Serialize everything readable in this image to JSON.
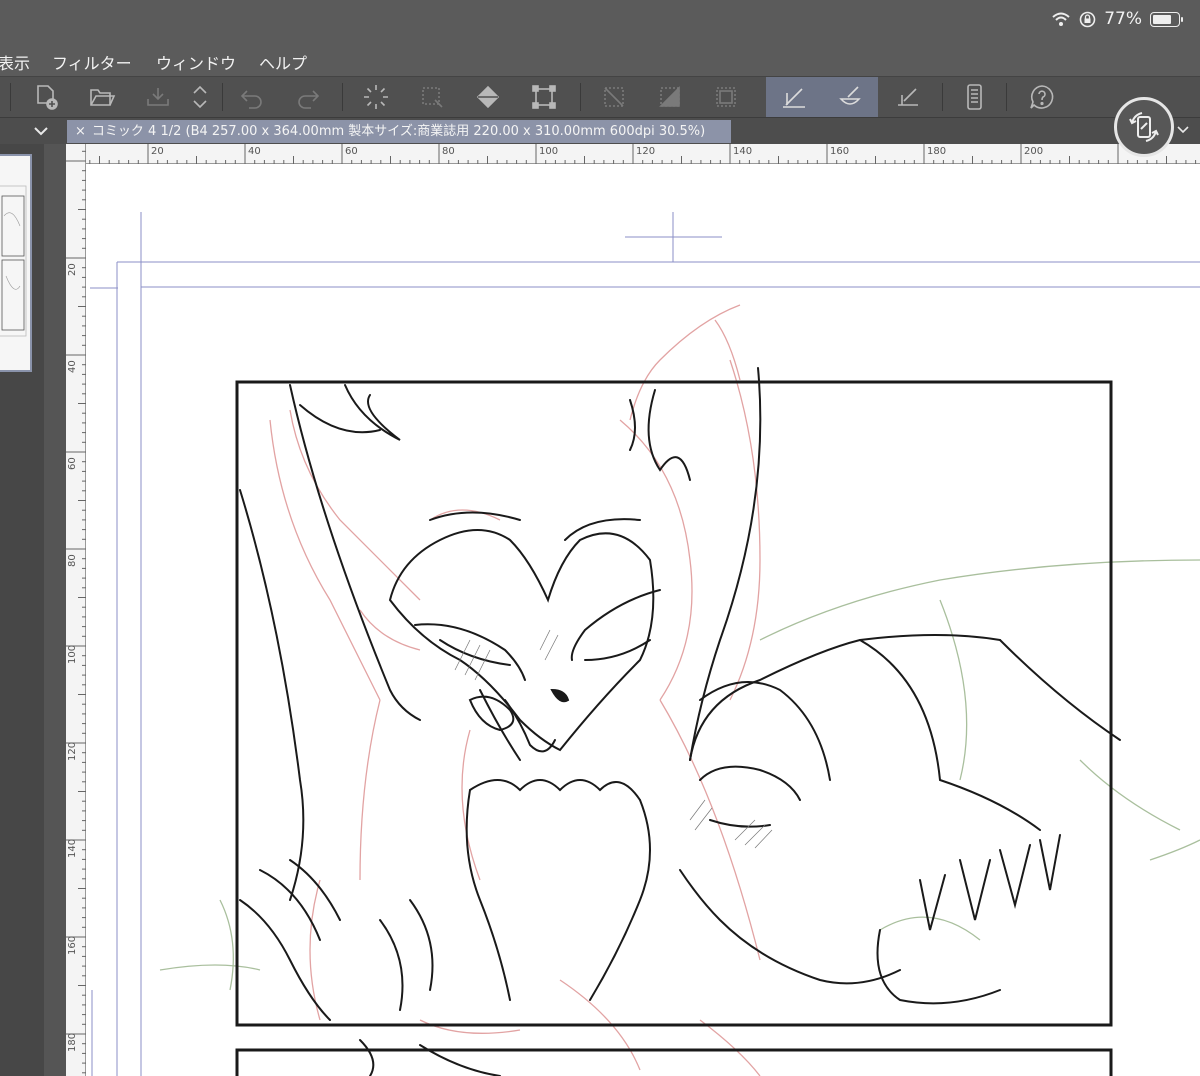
{
  "status": {
    "battery_percent_label": "77%",
    "battery_level": 0.77
  },
  "menu": [
    {
      "label": "表示"
    },
    {
      "label": "フィルター"
    },
    {
      "label": "ウィンドウ"
    },
    {
      "label": "ヘルプ"
    }
  ],
  "tab": {
    "close_glyph": "×",
    "title": "コミック 4 1/2 (B4 257.00 x 364.00mm 製本サイズ:商業誌用 220.00 x 310.00mm 600dpi 30.5%)"
  },
  "ruler": {
    "top_ticks": [
      "20",
      "40",
      "60",
      "80",
      "100",
      "120",
      "140",
      "160",
      "180",
      "200"
    ],
    "left_ticks": [
      "20",
      "40",
      "60",
      "80",
      "100",
      "120",
      "140",
      "160",
      "180"
    ]
  },
  "colors": {
    "ui_dark": "#5b5b5b",
    "toolbar": "#505050",
    "tab_active": "#8c93a8",
    "tool_active": "#6d7487",
    "canvas": "#ffffff",
    "guide": "#8b8fc7",
    "lineart": "#1a1a1a",
    "sketch_red": "#e2a3a3",
    "sketch_green": "#a9bf9d"
  }
}
